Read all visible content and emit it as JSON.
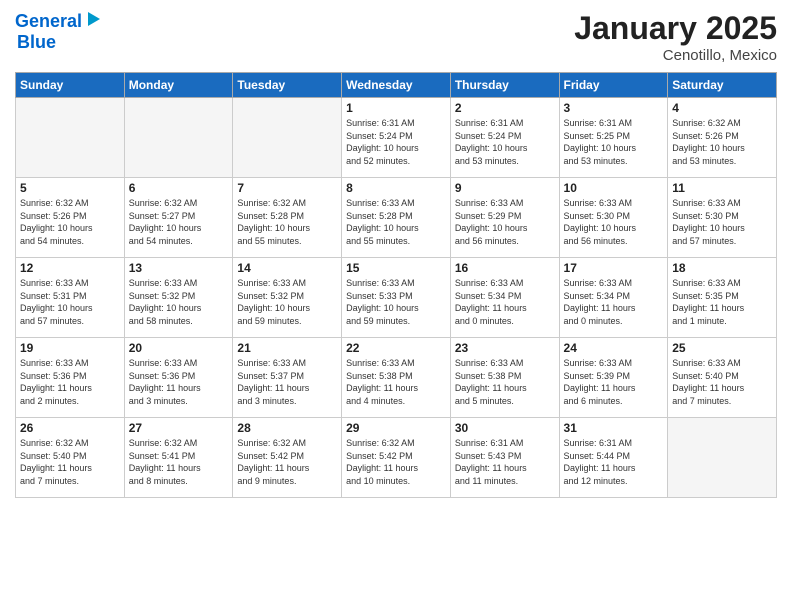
{
  "header": {
    "logo_line1": "General",
    "logo_line2": "Blue",
    "month": "January 2025",
    "location": "Cenotillo, Mexico"
  },
  "weekdays": [
    "Sunday",
    "Monday",
    "Tuesday",
    "Wednesday",
    "Thursday",
    "Friday",
    "Saturday"
  ],
  "weeks": [
    [
      {
        "day": "",
        "info": ""
      },
      {
        "day": "",
        "info": ""
      },
      {
        "day": "",
        "info": ""
      },
      {
        "day": "1",
        "info": "Sunrise: 6:31 AM\nSunset: 5:24 PM\nDaylight: 10 hours\nand 52 minutes."
      },
      {
        "day": "2",
        "info": "Sunrise: 6:31 AM\nSunset: 5:24 PM\nDaylight: 10 hours\nand 53 minutes."
      },
      {
        "day": "3",
        "info": "Sunrise: 6:31 AM\nSunset: 5:25 PM\nDaylight: 10 hours\nand 53 minutes."
      },
      {
        "day": "4",
        "info": "Sunrise: 6:32 AM\nSunset: 5:26 PM\nDaylight: 10 hours\nand 53 minutes."
      }
    ],
    [
      {
        "day": "5",
        "info": "Sunrise: 6:32 AM\nSunset: 5:26 PM\nDaylight: 10 hours\nand 54 minutes."
      },
      {
        "day": "6",
        "info": "Sunrise: 6:32 AM\nSunset: 5:27 PM\nDaylight: 10 hours\nand 54 minutes."
      },
      {
        "day": "7",
        "info": "Sunrise: 6:32 AM\nSunset: 5:28 PM\nDaylight: 10 hours\nand 55 minutes."
      },
      {
        "day": "8",
        "info": "Sunrise: 6:33 AM\nSunset: 5:28 PM\nDaylight: 10 hours\nand 55 minutes."
      },
      {
        "day": "9",
        "info": "Sunrise: 6:33 AM\nSunset: 5:29 PM\nDaylight: 10 hours\nand 56 minutes."
      },
      {
        "day": "10",
        "info": "Sunrise: 6:33 AM\nSunset: 5:30 PM\nDaylight: 10 hours\nand 56 minutes."
      },
      {
        "day": "11",
        "info": "Sunrise: 6:33 AM\nSunset: 5:30 PM\nDaylight: 10 hours\nand 57 minutes."
      }
    ],
    [
      {
        "day": "12",
        "info": "Sunrise: 6:33 AM\nSunset: 5:31 PM\nDaylight: 10 hours\nand 57 minutes."
      },
      {
        "day": "13",
        "info": "Sunrise: 6:33 AM\nSunset: 5:32 PM\nDaylight: 10 hours\nand 58 minutes."
      },
      {
        "day": "14",
        "info": "Sunrise: 6:33 AM\nSunset: 5:32 PM\nDaylight: 10 hours\nand 59 minutes."
      },
      {
        "day": "15",
        "info": "Sunrise: 6:33 AM\nSunset: 5:33 PM\nDaylight: 10 hours\nand 59 minutes."
      },
      {
        "day": "16",
        "info": "Sunrise: 6:33 AM\nSunset: 5:34 PM\nDaylight: 11 hours\nand 0 minutes."
      },
      {
        "day": "17",
        "info": "Sunrise: 6:33 AM\nSunset: 5:34 PM\nDaylight: 11 hours\nand 0 minutes."
      },
      {
        "day": "18",
        "info": "Sunrise: 6:33 AM\nSunset: 5:35 PM\nDaylight: 11 hours\nand 1 minute."
      }
    ],
    [
      {
        "day": "19",
        "info": "Sunrise: 6:33 AM\nSunset: 5:36 PM\nDaylight: 11 hours\nand 2 minutes."
      },
      {
        "day": "20",
        "info": "Sunrise: 6:33 AM\nSunset: 5:36 PM\nDaylight: 11 hours\nand 3 minutes."
      },
      {
        "day": "21",
        "info": "Sunrise: 6:33 AM\nSunset: 5:37 PM\nDaylight: 11 hours\nand 3 minutes."
      },
      {
        "day": "22",
        "info": "Sunrise: 6:33 AM\nSunset: 5:38 PM\nDaylight: 11 hours\nand 4 minutes."
      },
      {
        "day": "23",
        "info": "Sunrise: 6:33 AM\nSunset: 5:38 PM\nDaylight: 11 hours\nand 5 minutes."
      },
      {
        "day": "24",
        "info": "Sunrise: 6:33 AM\nSunset: 5:39 PM\nDaylight: 11 hours\nand 6 minutes."
      },
      {
        "day": "25",
        "info": "Sunrise: 6:33 AM\nSunset: 5:40 PM\nDaylight: 11 hours\nand 7 minutes."
      }
    ],
    [
      {
        "day": "26",
        "info": "Sunrise: 6:32 AM\nSunset: 5:40 PM\nDaylight: 11 hours\nand 7 minutes."
      },
      {
        "day": "27",
        "info": "Sunrise: 6:32 AM\nSunset: 5:41 PM\nDaylight: 11 hours\nand 8 minutes."
      },
      {
        "day": "28",
        "info": "Sunrise: 6:32 AM\nSunset: 5:42 PM\nDaylight: 11 hours\nand 9 minutes."
      },
      {
        "day": "29",
        "info": "Sunrise: 6:32 AM\nSunset: 5:42 PM\nDaylight: 11 hours\nand 10 minutes."
      },
      {
        "day": "30",
        "info": "Sunrise: 6:31 AM\nSunset: 5:43 PM\nDaylight: 11 hours\nand 11 minutes."
      },
      {
        "day": "31",
        "info": "Sunrise: 6:31 AM\nSunset: 5:44 PM\nDaylight: 11 hours\nand 12 minutes."
      },
      {
        "day": "",
        "info": ""
      }
    ]
  ]
}
